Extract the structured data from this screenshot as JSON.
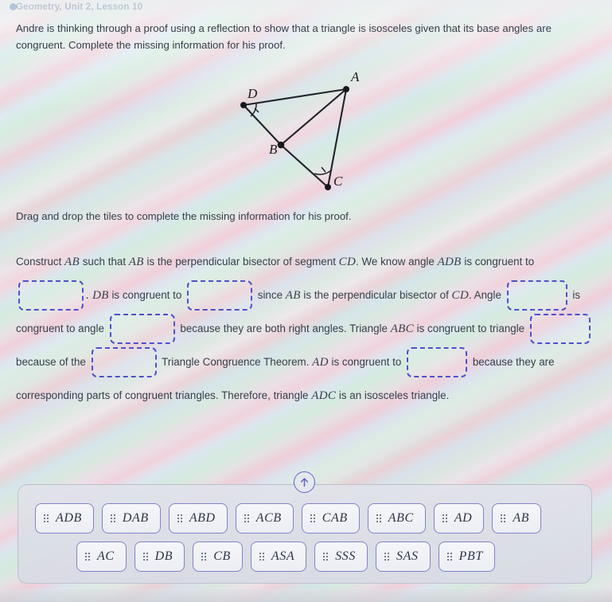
{
  "header": {
    "breadcrumb": "Geometry, Unit 2, Lesson 10"
  },
  "prompt": {
    "line1": "Andre is thinking through a proof using a reflection to show that a triangle is isosceles given that its base angles are congruent.",
    "line2": "Complete the missing information for his proof."
  },
  "figure": {
    "caption_points": [
      "A",
      "D",
      "B",
      "C"
    ],
    "labels": {
      "a": "A",
      "b": "B",
      "c": "C",
      "d": "D"
    },
    "tick_marks": 2,
    "segments": [
      "D-A",
      "D-B",
      "B-A",
      "B-C",
      "C-A"
    ]
  },
  "instruction": {
    "text": "Drag and drop the tiles to complete the missing information for his proof."
  },
  "proof": {
    "t1": "Construct",
    "m1": "AB",
    "t2": "such that",
    "m2": "AB",
    "t3": "is the perpendicular bisector of segment",
    "m3": "CD",
    "t4": ". We know angle",
    "m4": "ADB",
    "t5": "is congruent to",
    "m5": ". DB",
    "t6": "is congruent to",
    "t7": "since",
    "m6": "AB",
    "t8": "is the perpendicular bisector of",
    "m7": "CD",
    "t9": ".  Angle",
    "t10": "is congruent to angle",
    "t11": "because they are both right angles. Triangle",
    "m8": "ABC",
    "t12": "is congruent to triangle",
    "t13": "because of the",
    "t14": "Triangle Congruence Theorem.",
    "m9": "AD",
    "t15": "is congruent to",
    "t16": "because they are corresponding parts of congruent",
    "t17": "triangles. Therefore, triangle",
    "m10": "ADC",
    "t18": "is an isosceles triangle.",
    "blanks": [
      {
        "id": "blank-1",
        "value": ""
      },
      {
        "id": "blank-2",
        "value": ""
      },
      {
        "id": "blank-3",
        "value": ""
      },
      {
        "id": "blank-4",
        "value": ""
      },
      {
        "id": "blank-5",
        "value": ""
      },
      {
        "id": "blank-6",
        "value": ""
      },
      {
        "id": "blank-7",
        "value": ""
      }
    ]
  },
  "tray": {
    "collapse_icon": "arrow-up-icon",
    "rows": [
      {
        "tiles": [
          {
            "label": "ADB"
          },
          {
            "label": "DAB"
          },
          {
            "label": "ABD"
          },
          {
            "label": "ACB"
          },
          {
            "label": "CAB"
          },
          {
            "label": "ABC"
          },
          {
            "label": "AD"
          },
          {
            "label": "AB"
          }
        ]
      },
      {
        "tiles": [
          {
            "label": "AC"
          },
          {
            "label": "DB"
          },
          {
            "label": "CB"
          },
          {
            "label": "ASA"
          },
          {
            "label": "SSS"
          },
          {
            "label": "SAS"
          },
          {
            "label": "PBT"
          }
        ]
      }
    ]
  },
  "colors": {
    "dropzone_border": "#4b4fc8",
    "tile_border": "#7e83c8",
    "text": "#333b47",
    "tray_bg": "#e1e3eb"
  }
}
